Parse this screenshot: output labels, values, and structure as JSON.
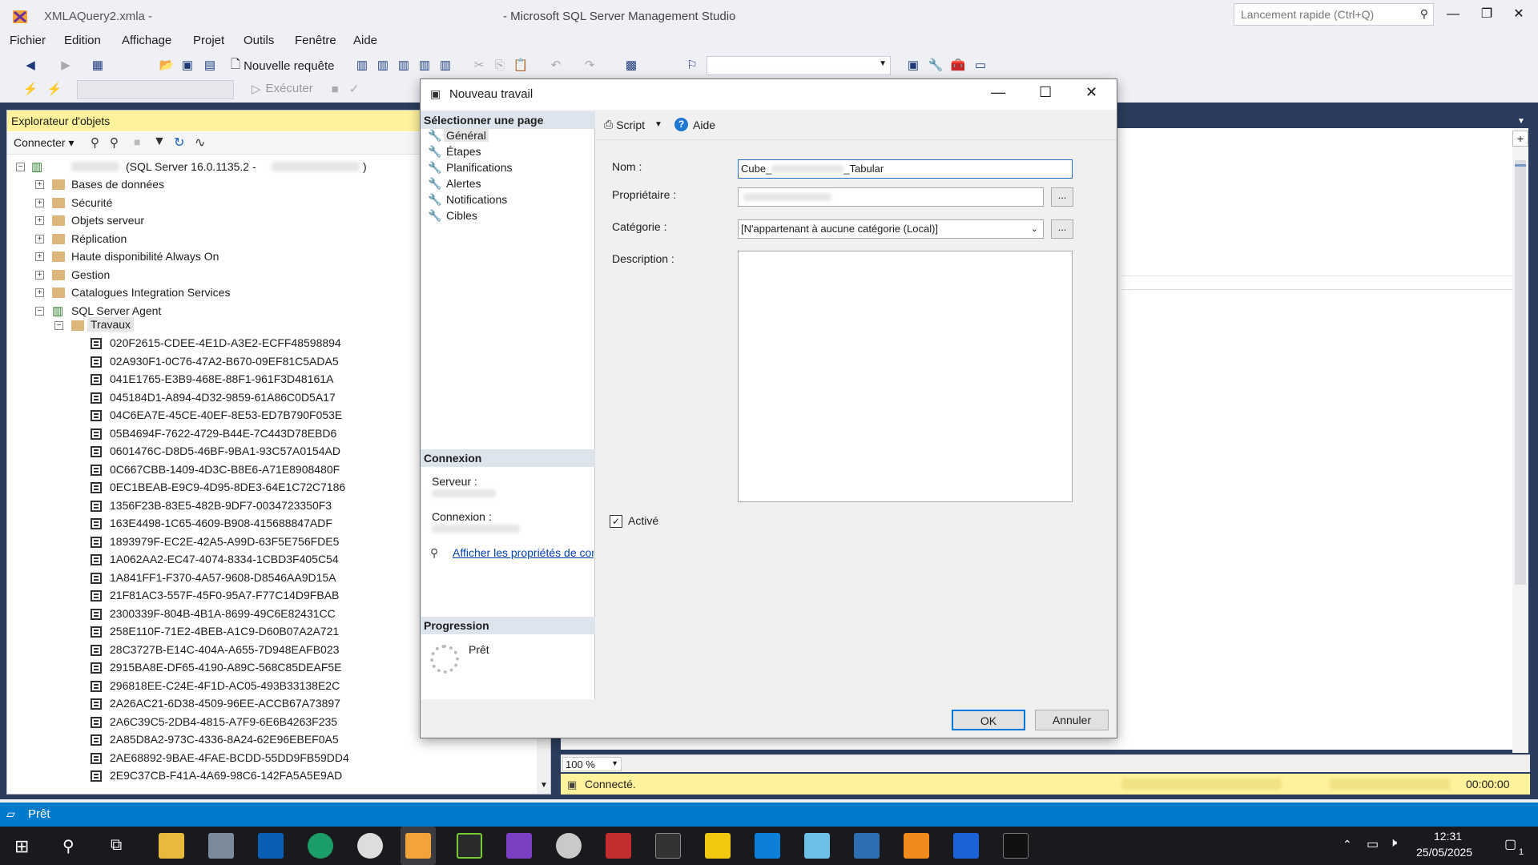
{
  "window": {
    "doc_title": "XMLAQuery2.xmla - ",
    "app_title": "- Microsoft SQL Server Management Studio",
    "quick_launch_placeholder": "Lancement rapide (Ctrl+Q)"
  },
  "menu": [
    "Fichier",
    "Edition",
    "Affichage",
    "Projet",
    "Outils",
    "Fenêtre",
    "Aide"
  ],
  "toolbar": {
    "new_query": "Nouvelle requête",
    "execute": "Exécuter"
  },
  "object_explorer": {
    "title": "Explorateur d'objets",
    "connect": "Connecter",
    "server": "(SQL Server 16.0.1135.2 -",
    "server_end": ")",
    "nodes": [
      "Bases de données",
      "Sécurité",
      "Objets serveur",
      "Réplication",
      "Haute disponibilité Always On",
      "Gestion",
      "Catalogues Integration Services",
      "SQL Server Agent"
    ],
    "jobs_folder": "Travaux",
    "jobs": [
      "020F2615-CDEE-4E1D-A3E2-ECFF48598894",
      "02A930F1-0C76-47A2-B670-09EF81C5ADA5",
      "041E1765-E3B9-468E-88F1-961F3D48161A",
      "045184D1-A894-4D32-9859-61A86C0D5A17",
      "04C6EA7E-45CE-40EF-8E53-ED7B790F053E",
      "05B4694F-7622-4729-B44E-7C443D78EBD6",
      "0601476C-D8D5-46BF-9BA1-93C57A0154AD",
      "0C667CBB-1409-4D3C-B8E6-A71E8908480F",
      "0EC1BEAB-E9C9-4D95-8DE3-64E1C72C7186",
      "1356F23B-83E5-482B-9DF7-0034723350F3",
      "163E4498-1C65-4609-B908-415688847ADF",
      "1893979F-EC2E-42A5-A99D-63F5E756FDE5",
      "1A062AA2-EC47-4074-8334-1CBD3F405C54",
      "1A841FF1-F370-4A57-9608-D8546AA9D15A",
      "21F81AC3-557F-45F0-95A7-F77C14D9FBAB",
      "2300339F-804B-4B1A-8699-49C6E82431CC",
      "258E110F-71E2-4BEB-A1C9-D60B07A2A721",
      "28C3727B-E14C-404A-A655-7D948EAFB023",
      "2915BA8E-DF65-4190-A89C-568C85DEAF5E",
      "296818EE-C24E-4F1D-AC05-493B33138E2C",
      "2A26AC21-6D38-4509-96EE-ACCB67A73897",
      "2A6C39C5-2DB4-4815-A7F9-6E6B4263F235",
      "2A85D8A2-973C-4336-8A24-62E96EBEF0A5",
      "2AE68892-9BAE-4FAE-BCDD-55DD9FB59DD4",
      "2E9C37CB-F41A-4A69-98C6-142FA5A5E9AD"
    ]
  },
  "dialog": {
    "title": "Nouveau travail",
    "select_page": "Sélectionner une page",
    "pages": [
      "Général",
      "Étapes",
      "Planifications",
      "Alertes",
      "Notifications",
      "Cibles"
    ],
    "script": "Script",
    "help": "Aide",
    "name_label": "Nom :",
    "name_value": "Cube_",
    "name_suffix": "_Tabular",
    "owner_label": "Propriétaire :",
    "category_label": "Catégorie :",
    "category_value": "[N'appartenant à aucune catégorie (Local)]",
    "description_label": "Description :",
    "enabled_label": "Activé",
    "browse": "...",
    "connection_header": "Connexion",
    "server_label": "Serveur :",
    "connection_label": "Connexion :",
    "view_props_link": "Afficher les propriétés de conn",
    "progress_header": "Progression",
    "progress_status": "Prêt",
    "ok": "OK",
    "cancel": "Annuler"
  },
  "editor": {
    "zoom": "100 %",
    "connected": "Connecté.",
    "elapsed": "00:00:00"
  },
  "status_bar": {
    "text": "Prêt"
  },
  "taskbar": {
    "time": "12:31",
    "date": "25/05/2025",
    "notif_count": "1"
  }
}
